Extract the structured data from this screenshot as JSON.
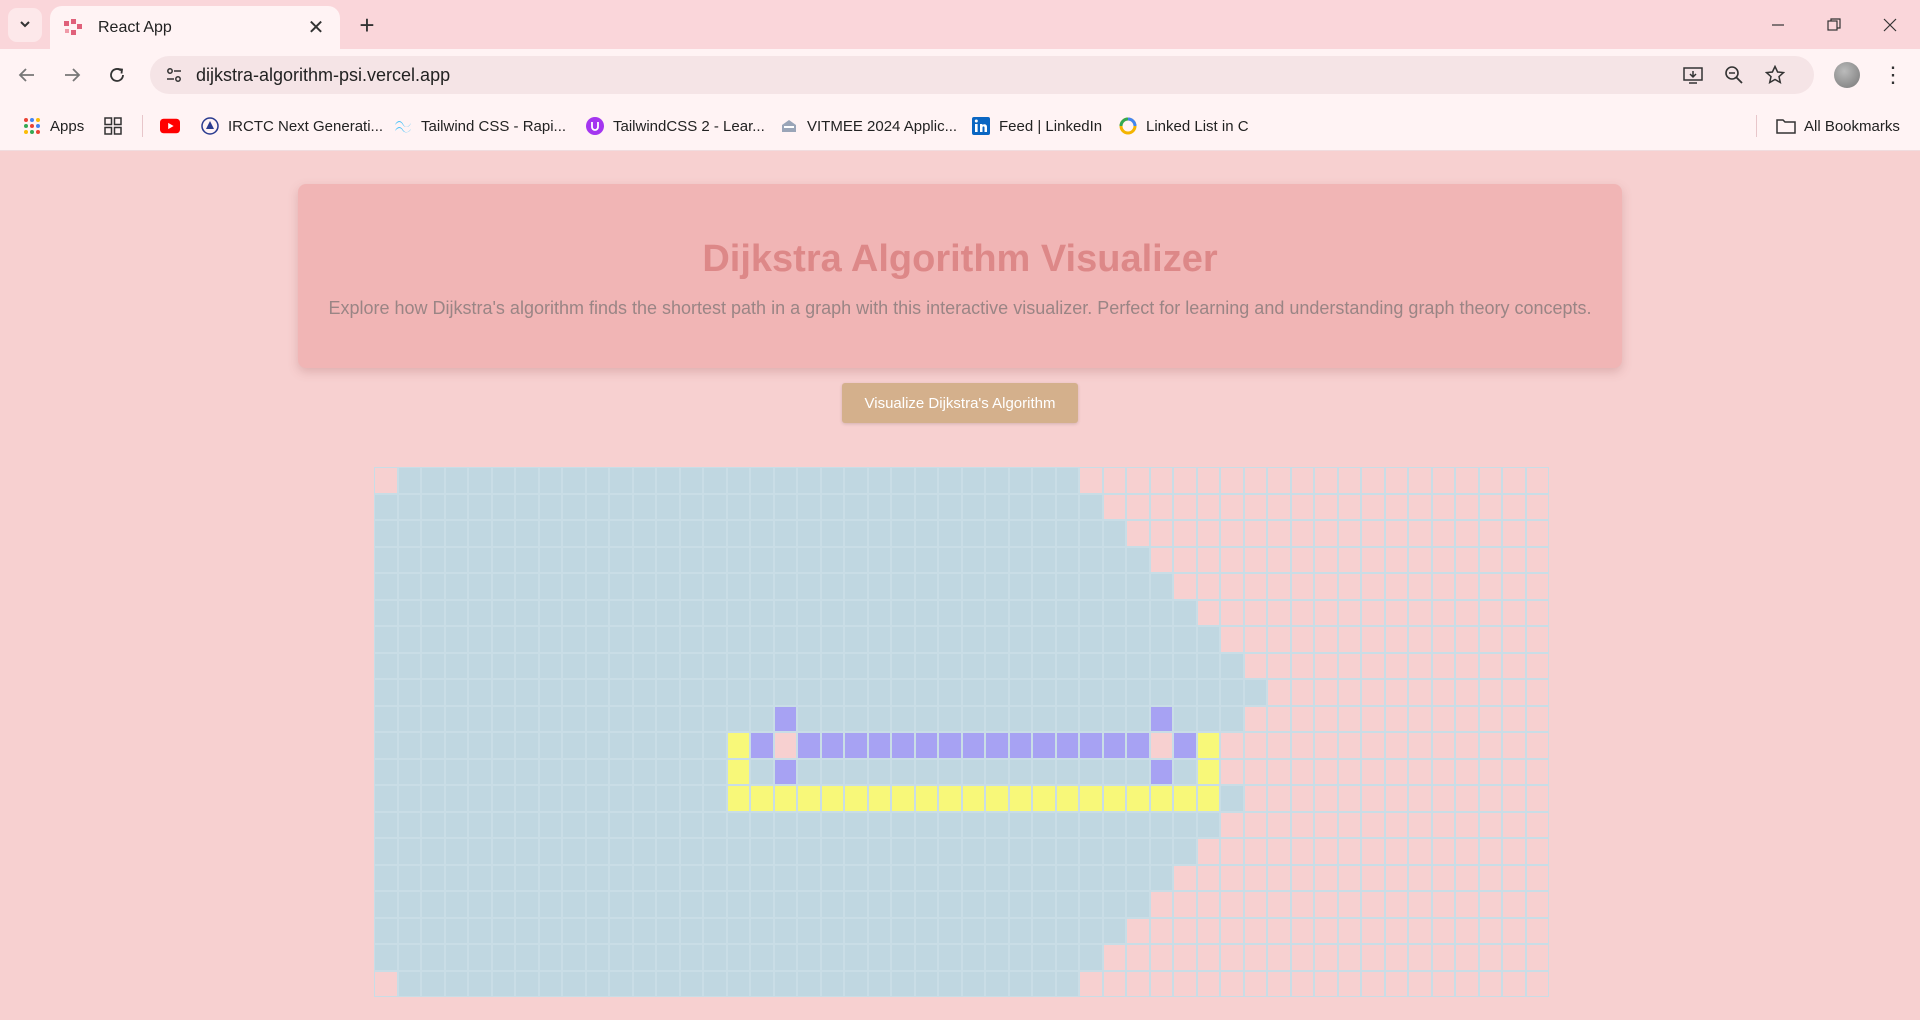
{
  "browser": {
    "tab": {
      "title": "React App",
      "favicon": "react-app-favicon"
    },
    "url": "dijkstra-algorithm-psi.vercel.app",
    "window_controls": [
      "minimize",
      "restore",
      "close"
    ],
    "bookmarks": [
      {
        "label": "Apps",
        "icon": "apps-grid-icon"
      },
      {
        "label": "",
        "icon": "tab-groups-icon"
      },
      {
        "label": "",
        "icon": "youtube-icon"
      },
      {
        "label": "IRCTC Next Generati...",
        "icon": "irctc-icon"
      },
      {
        "label": "Tailwind CSS - Rapi...",
        "icon": "tailwind-icon"
      },
      {
        "label": "TailwindCSS 2 - Lear...",
        "icon": "udemy-icon"
      },
      {
        "label": "VITMEE 2024 Applic...",
        "icon": "vit-icon"
      },
      {
        "label": "Feed | LinkedIn",
        "icon": "linkedin-icon"
      },
      {
        "label": "Linked List in C",
        "icon": "linked-list-icon"
      }
    ],
    "all_bookmarks": "All Bookmarks"
  },
  "header": {
    "title": "Dijkstra Algorithm Visualizer",
    "subtitle": "Explore how Dijkstra's algorithm finds the shortest path in a graph with this interactive visualizer. Perfect for learning and understanding graph theory concepts."
  },
  "visualize_button": "Visualize Dijkstra's Algorithm",
  "grid": {
    "rows": 20,
    "cols": 50,
    "colors": {
      "unvisited": "#f7d0d0",
      "visited": "#c0d7e1",
      "wall": "#a7a2f3",
      "path": "#f8f879"
    },
    "visited_ranges": [
      [
        [
          1,
          29
        ]
      ],
      [
        [
          0,
          30
        ]
      ],
      [
        [
          0,
          31
        ]
      ],
      [
        [
          0,
          32
        ]
      ],
      [
        [
          0,
          33
        ]
      ],
      [
        [
          0,
          34
        ]
      ],
      [
        [
          0,
          35
        ]
      ],
      [
        [
          0,
          36
        ]
      ],
      [
        [
          0,
          37
        ]
      ],
      [
        [
          0,
          36
        ]
      ],
      [
        [
          0,
          34
        ]
      ],
      [
        [
          0,
          34
        ]
      ],
      [
        [
          0,
          36
        ]
      ],
      [
        [
          0,
          35
        ]
      ],
      [
        [
          0,
          34
        ]
      ],
      [
        [
          0,
          33
        ]
      ],
      [
        [
          0,
          32
        ]
      ],
      [
        [
          0,
          31
        ]
      ],
      [
        [
          0,
          30
        ]
      ],
      [
        [
          1,
          29
        ]
      ]
    ],
    "walls": [
      [
        9,
        17
      ],
      [
        9,
        33
      ],
      [
        10,
        16
      ],
      [
        10,
        18
      ],
      [
        10,
        19
      ],
      [
        10,
        20
      ],
      [
        10,
        21
      ],
      [
        10,
        22
      ],
      [
        10,
        23
      ],
      [
        10,
        24
      ],
      [
        10,
        25
      ],
      [
        10,
        26
      ],
      [
        10,
        27
      ],
      [
        10,
        28
      ],
      [
        10,
        29
      ],
      [
        10,
        30
      ],
      [
        10,
        31
      ],
      [
        10,
        32
      ],
      [
        10,
        34
      ],
      [
        11,
        17
      ],
      [
        11,
        33
      ]
    ],
    "path": [
      [
        10,
        15
      ],
      [
        10,
        35
      ],
      [
        11,
        15
      ],
      [
        11,
        35
      ],
      [
        12,
        15
      ],
      [
        12,
        16
      ],
      [
        12,
        17
      ],
      [
        12,
        18
      ],
      [
        12,
        19
      ],
      [
        12,
        20
      ],
      [
        12,
        21
      ],
      [
        12,
        22
      ],
      [
        12,
        23
      ],
      [
        12,
        24
      ],
      [
        12,
        25
      ],
      [
        12,
        26
      ],
      [
        12,
        27
      ],
      [
        12,
        28
      ],
      [
        12,
        29
      ],
      [
        12,
        30
      ],
      [
        12,
        31
      ],
      [
        12,
        32
      ],
      [
        12,
        33
      ],
      [
        12,
        34
      ],
      [
        12,
        35
      ]
    ],
    "unvisited_in_range": [
      [
        10,
        17
      ],
      [
        10,
        33
      ]
    ]
  }
}
